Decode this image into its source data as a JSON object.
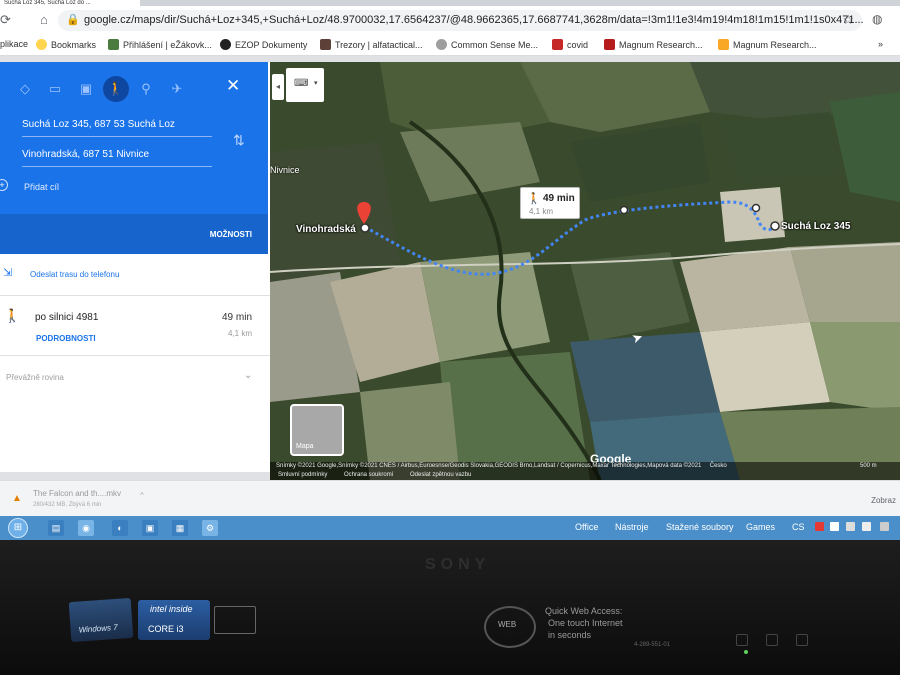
{
  "browser": {
    "tab_title": "Suchá Loz 345, Suchá Loz do ...",
    "url": "google.cz/maps/dir/Suchá+Loz+345,+Suchá+Loz/48.9700032,17.6564237/@48.9662365,17.6687741,3628m/data=!3m1!1e3!4m19!4m18!1m15!1m1!1s0x471...",
    "bookmarks": [
      {
        "label": "plikace",
        "color": "#ffffff"
      },
      {
        "label": "Bookmarks",
        "color": "#ffd54f"
      },
      {
        "label": "Přihlášení | eŽákovk...",
        "color": "#4a7c3f"
      },
      {
        "label": "EZOP Dokumenty",
        "color": "#212121"
      },
      {
        "label": "Trezory | alfatactical...",
        "color": "#5d4037"
      },
      {
        "label": "Common Sense Me...",
        "color": "#9e9e9e"
      },
      {
        "label": "covid",
        "color": "#c62828"
      },
      {
        "label": "Magnum Research...",
        "color": "#b71c1c"
      },
      {
        "label": "Magnum Research...",
        "color": "#f9a825"
      }
    ]
  },
  "directions": {
    "modes": [
      "best-icon",
      "car-icon",
      "transit-icon",
      "walk-icon",
      "bike-icon",
      "flight-icon"
    ],
    "active_mode": "walk-icon",
    "origin": "Suchá Loz 345, 687 53 Suchá Loz",
    "destination": "Vinohradská, 687 51 Nivnice",
    "add_destination": "Přidat cíl",
    "options": "MOŽNOSTI",
    "send_to_phone": "Odeslat trasu do telefonu",
    "route": {
      "name": "po silnici 4981",
      "time": "49 min",
      "distance": "4,1 km",
      "details": "PODROBNOSTI"
    },
    "terrain": "Převážně rovina"
  },
  "map": {
    "time_box": {
      "time": "49 min",
      "distance": "4,1 km"
    },
    "labels": {
      "nivnice": "Nivnice",
      "vinohradska": "Vinohradská",
      "sucha_loz": "Suchá Loz 345"
    },
    "layer_toggle": "Mapa",
    "google": "Google",
    "attribution": "Snímky ©2021 Google,Snímky ©2021 CNES / Airbus,Euroesnse/Geodis Slovakia,GEODIS Brno,Landsat / Copernicus,Maxar Technologies,Mapová data ©2021",
    "attribution_country": "Česko",
    "attribution_links": [
      "Smluvní podmínky",
      "Ochrana soukromí",
      "Odeslat zpětnou vazbu"
    ],
    "scale": "500 m",
    "route_color": "#4285f4"
  },
  "downloads": {
    "filename": "The Falcon and th....mkv",
    "status": "280/432 MB, Zbývá 6 min",
    "show_all": "Zobraz"
  },
  "taskbar": {
    "items": [
      "Office",
      "Nástroje",
      "Stažené soubory",
      "Games",
      "CS"
    ]
  },
  "bezel": {
    "brand": "SONY",
    "windows_badge": "Windows 7",
    "intel_inside": "intel inside",
    "intel_model": "CORE i3",
    "web_button": "WEB",
    "qwa_title": "Quick Web Access:",
    "qwa_line1": "One touch Internet",
    "qwa_line2": "in seconds",
    "serial": "4-289-551-01"
  }
}
